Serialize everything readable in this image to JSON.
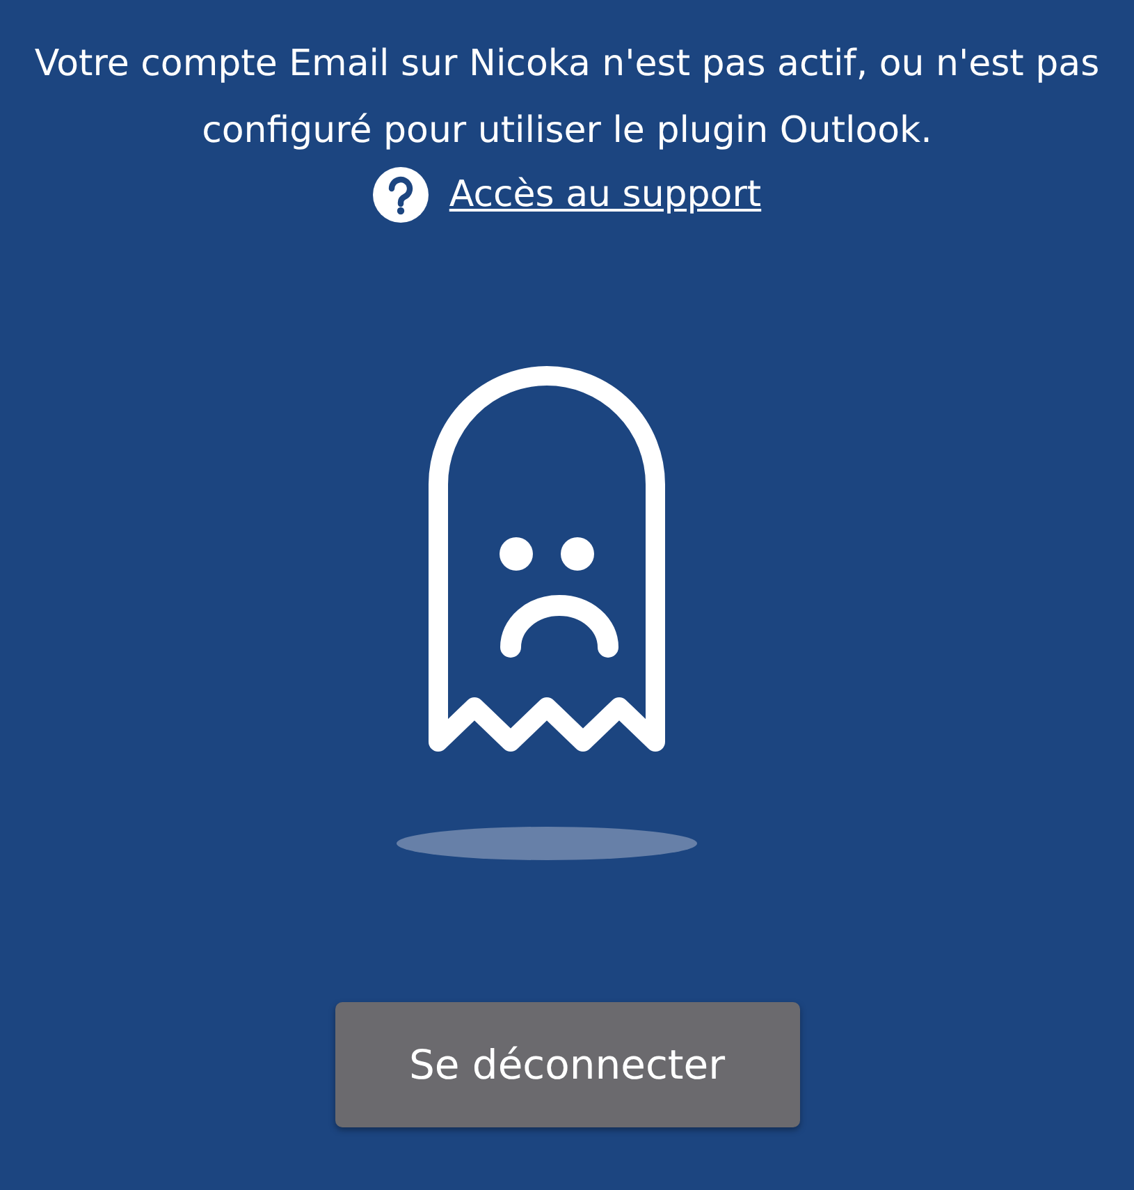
{
  "message": "Votre compte Email sur Nicoka n'est pas actif, ou n'est pas configuré pour utiliser le plugin Outlook.",
  "support_link": {
    "label": "Accès au support"
  },
  "buttons": [
    {
      "label": "Se déconnecter"
    }
  ]
}
